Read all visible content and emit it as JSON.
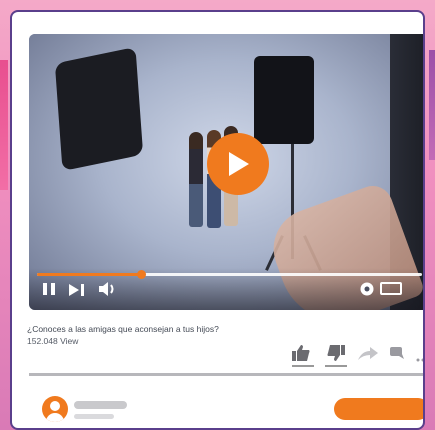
{
  "video": {
    "title": "¿Conoces a las amigas que aconsejan a tus hijos?",
    "views": "152.048 View",
    "progress": 0.27,
    "accent_color": "#f07a1e"
  },
  "player_controls": [
    "pause-icon",
    "skip-next-icon",
    "volume-icon",
    "settings-icon",
    "fullscreen-icon"
  ],
  "action_icons": [
    "thumbs-up-icon",
    "thumbs-down-icon",
    "share-icon",
    "comment-icon",
    "more-icon"
  ],
  "colors": {
    "frame_border": "#5a3f8c",
    "divider": "#b7b7bb",
    "placeholder": "#c9c9cc"
  }
}
